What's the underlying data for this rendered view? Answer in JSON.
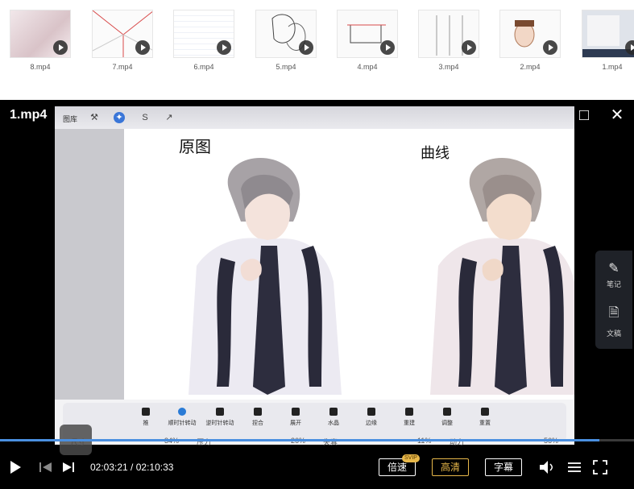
{
  "thumbnails": [
    {
      "label": "8.mp4"
    },
    {
      "label": "7.mp4"
    },
    {
      "label": "6.mp4"
    },
    {
      "label": "5.mp4"
    },
    {
      "label": "4.mp4"
    },
    {
      "label": "3.mp4"
    },
    {
      "label": "2.mp4"
    },
    {
      "label": "1.mp4"
    }
  ],
  "player": {
    "title": "1.mp4",
    "current_time": "02:03:21",
    "duration": "02:10:33",
    "time_separator": " / ",
    "progress_fraction": 0.945,
    "speed_label": "倍速",
    "speed_badge": "SVIP",
    "quality_label": "高清",
    "subtitle_label": "字幕",
    "accent_color": "#4a8fe0",
    "badge_color": "#e8b84a"
  },
  "side_panel": {
    "notes_label": "笔记",
    "doc_label": "文稿",
    "notes_icon": "notes-icon",
    "doc_icon": "document-icon"
  },
  "video_content": {
    "procreate_top_label": "图库",
    "canvas_label_left": "原图",
    "canvas_label_right": "曲线",
    "tools": [
      {
        "label": "推"
      },
      {
        "label": "顺时针转动"
      },
      {
        "label": "逆时针转动"
      },
      {
        "label": "捏合"
      },
      {
        "label": "展开"
      },
      {
        "label": "水晶"
      },
      {
        "label": "边缘"
      },
      {
        "label": "重建"
      },
      {
        "label": "调整"
      },
      {
        "label": "重置"
      }
    ],
    "sliders": [
      {
        "label": "尺寸",
        "value": "34%"
      },
      {
        "label": "压力",
        "value": "26%"
      },
      {
        "label": "失真",
        "value": "11%"
      },
      {
        "label": "动力",
        "value": "56%"
      }
    ]
  }
}
